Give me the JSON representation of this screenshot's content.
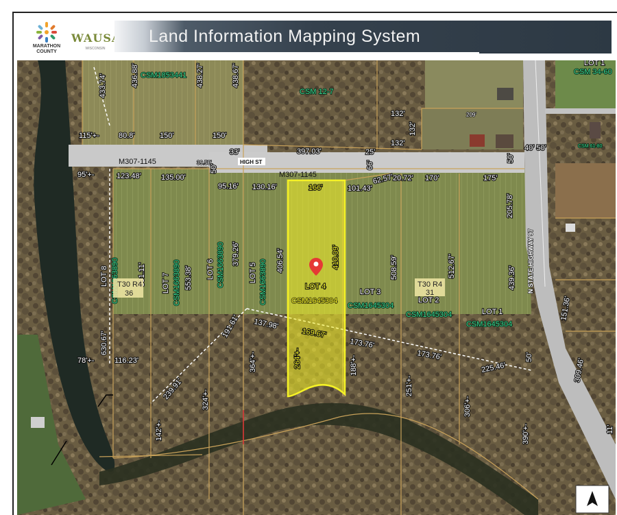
{
  "header": {
    "title": "Land Information Mapping System",
    "marathon_logo": {
      "line1": "MARATHON",
      "line2": "COUNTY"
    },
    "wausau_logo": {
      "name": "WAUSAU",
      "sub": "WISCONSIN"
    }
  },
  "map": {
    "road_labels": {
      "m307_top": "M307-1145",
      "m307_mid": "M307-1145",
      "high_st": "HIGH ST",
      "highway": "N STATE HIGHWAY 97"
    },
    "dimensions": {
      "d_433": "433.74'",
      "d_436": "436.88'",
      "d_438_27": "438.27'",
      "d_438_67": "438.67'",
      "d_115": "115'+-",
      "d_80_8": "80.8'",
      "d_150a": "150'",
      "d_150b": "150'",
      "d_33": "33'",
      "d_397": "397.03'",
      "d_25": "25'",
      "d_132a": "132'",
      "d_132b": "132'",
      "d_132c": "132'",
      "d_209": "209'",
      "d_40_50": "40' 50'",
      "d_95": "95'+-",
      "d_123": "123.48'",
      "d_135": "135.00'",
      "d_39": "39.50'",
      "d_66": "66'",
      "d_50a": "50'",
      "d_50b": "50'",
      "d_95_16": "95.16'",
      "d_130": "130.16'",
      "d_166": "166'",
      "d_101": "101.43'",
      "d_62": "62.57'",
      "d_20": "20.72'",
      "d_170": "170'",
      "d_175": "175'",
      "d_205": "205.78'",
      "d_591": "591.11'",
      "d_553": "553.38'",
      "d_379": "379.26'",
      "d_406": "406.54'",
      "d_410": "410.09'",
      "d_508": "508.59'",
      "d_512": "512.67'",
      "d_439": "439.36'",
      "d_151": "151.36'",
      "d_630": "630.67'",
      "d_137": "137.98'",
      "d_191": "191.61'",
      "d_169": "169.67'",
      "d_173a": "173.76'",
      "d_173b": "173.76'",
      "d_225": "225.46'",
      "d_309": "309.46'",
      "d_78": "78'+-",
      "d_116": "116.23'",
      "d_364": "364'+-",
      "d_264": "264'+-",
      "d_188": "188'+-",
      "d_251": "251'+-",
      "d_306": "306'+-",
      "d_239": "239.91'",
      "d_324": "324'+-",
      "d_142": "142'+-",
      "d_390": "390'+-",
      "d_11": "11'"
    },
    "lots": {
      "lot8": "LOT 8",
      "lot7": "LOT 7",
      "lot6": "LOT 6",
      "lot5": "LOT 5",
      "lot4": "LOT 4",
      "lot3": "LOT 3",
      "lot2": "LOT 2",
      "lot1": "LOT 1",
      "lot_tr": "LOT 1"
    },
    "csm": {
      "csm1853441": "CSM1853441",
      "csm12_7": "CSM 12-7",
      "csm34": "CSM 34-60",
      "csm_lot8": "CSM1663890",
      "csm_lot7": "CSM1663890",
      "csm_lot6": "CSM1663890",
      "csm_lot5": "CSM1663890",
      "csm_lot4": "CSM1645304",
      "csm_lot3": "CSM1645304",
      "csm_lot2": "CSM1645304",
      "csm_lot1": "CSM1645304",
      "csm_small": "CSM 61-80"
    },
    "township": {
      "left_a": "T30 R4",
      "left_b": "36",
      "right_a": "T30 R4",
      "right_b": "31"
    },
    "colors": {
      "highlight": "#f5f226",
      "marker": "#e53935",
      "road": "#cfcfcf",
      "parcel_line": "#c9a25a"
    }
  }
}
